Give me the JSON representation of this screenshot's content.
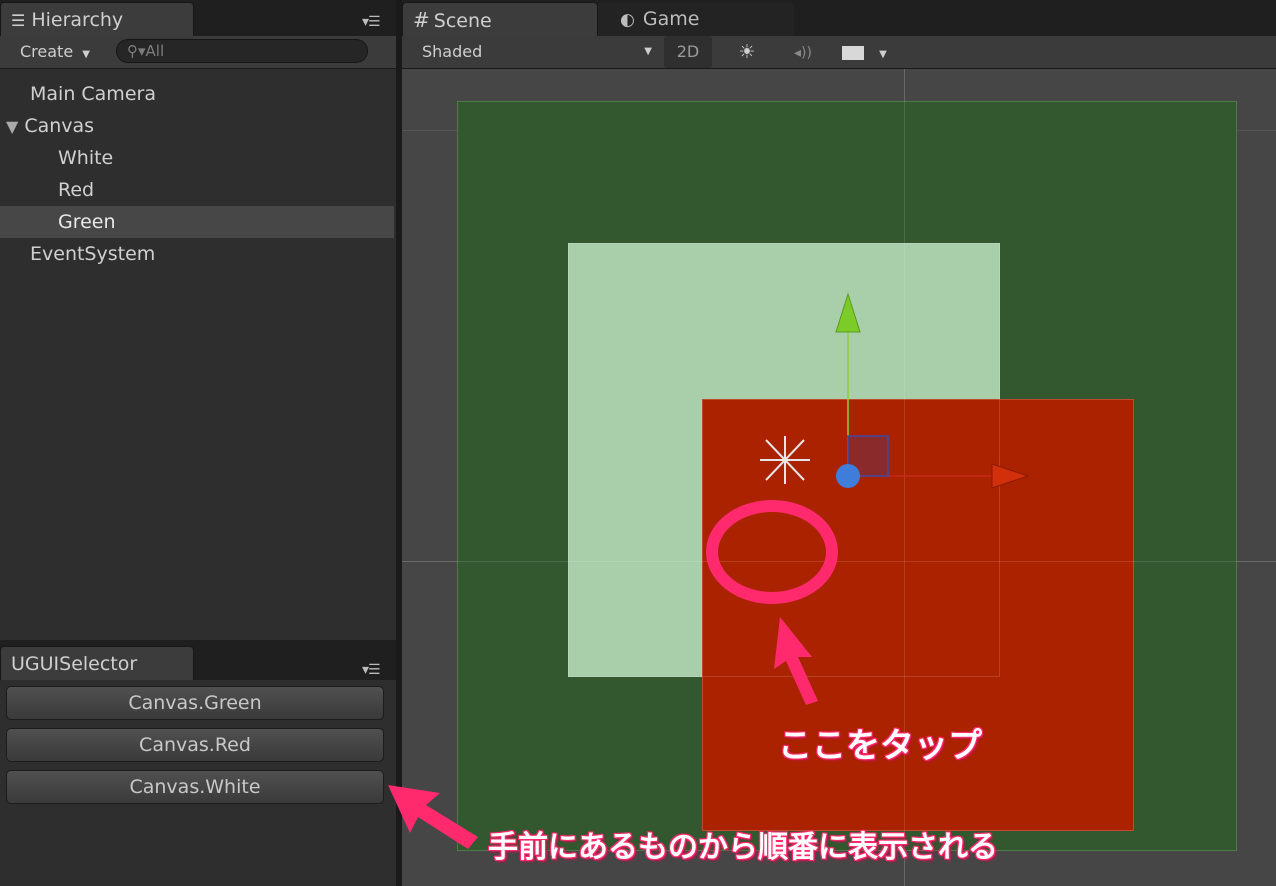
{
  "hierarchy": {
    "tab_title": "Hierarchy",
    "create_label": "Create",
    "search_placeholder": "All",
    "items": [
      {
        "label": "Main Camera"
      },
      {
        "label": "Canvas"
      },
      {
        "label": "White"
      },
      {
        "label": "Red"
      },
      {
        "label": "Green"
      },
      {
        "label": "EventSystem"
      }
    ]
  },
  "selector": {
    "tab_title": "UGUISelector",
    "buttons": [
      {
        "label": "Canvas.Green"
      },
      {
        "label": "Canvas.Red"
      },
      {
        "label": "Canvas.White"
      }
    ]
  },
  "scene": {
    "tabs": [
      {
        "label": "Scene"
      },
      {
        "label": "Game"
      }
    ],
    "shading_mode": "Shaded",
    "mode_2d_label": "2D"
  },
  "annotations": {
    "tap_here": "ここをタップ",
    "order_note": "手前にあるものから順番に表示される"
  },
  "colors": {
    "green_canvas": "#33572f",
    "white_panel": "#a9ceaa",
    "red_panel": "#ab2200",
    "annotation_pink": "#ff2a6d"
  }
}
